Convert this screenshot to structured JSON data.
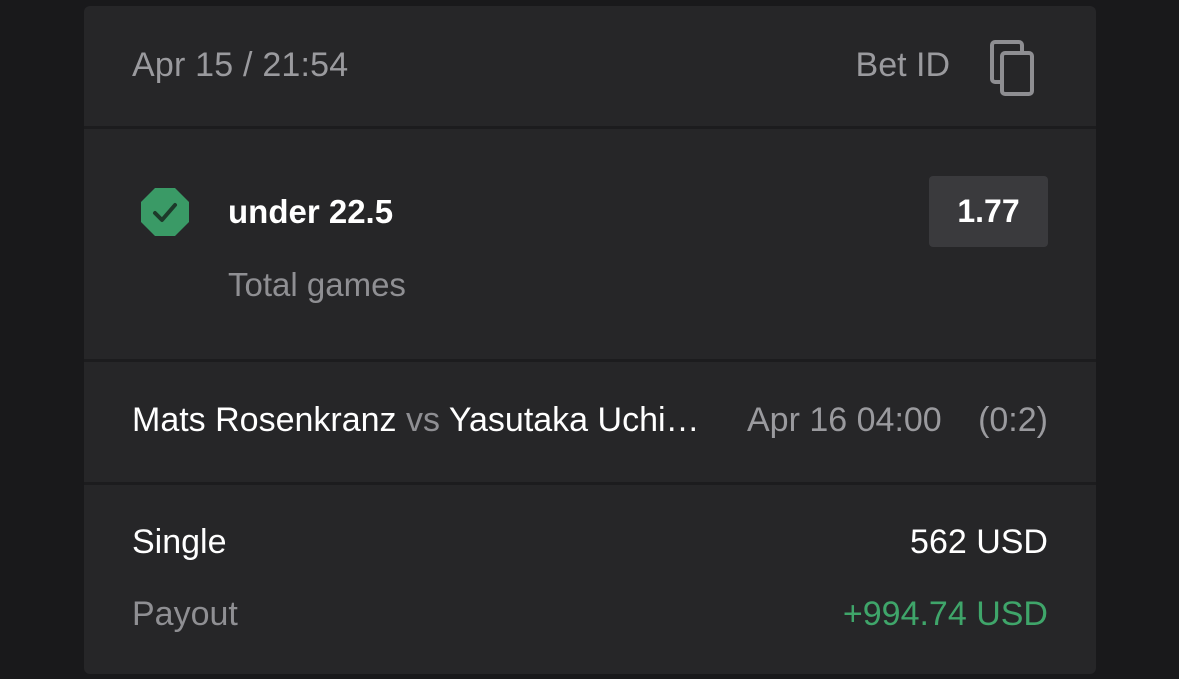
{
  "header": {
    "datetime": "Apr 15 / 21:54",
    "bet_id_label": "Bet ID",
    "copy_icon": "copy-icon"
  },
  "bet": {
    "status_icon": "check-octagon-icon",
    "status_color": "#3a9a66",
    "selection": "under 22.5",
    "market": "Total games",
    "odds": "1.77"
  },
  "event": {
    "player1": "Mats Rosenkranz",
    "vs": "vs",
    "player2": "Yasutaka Uchi…",
    "datetime": "Apr 16 04:00",
    "score": "(0:2)"
  },
  "summary": {
    "bet_type": "Single",
    "stake": "562 USD",
    "payout_label": "Payout",
    "payout": "+994.74 USD",
    "payout_color": "#3fa56a"
  }
}
